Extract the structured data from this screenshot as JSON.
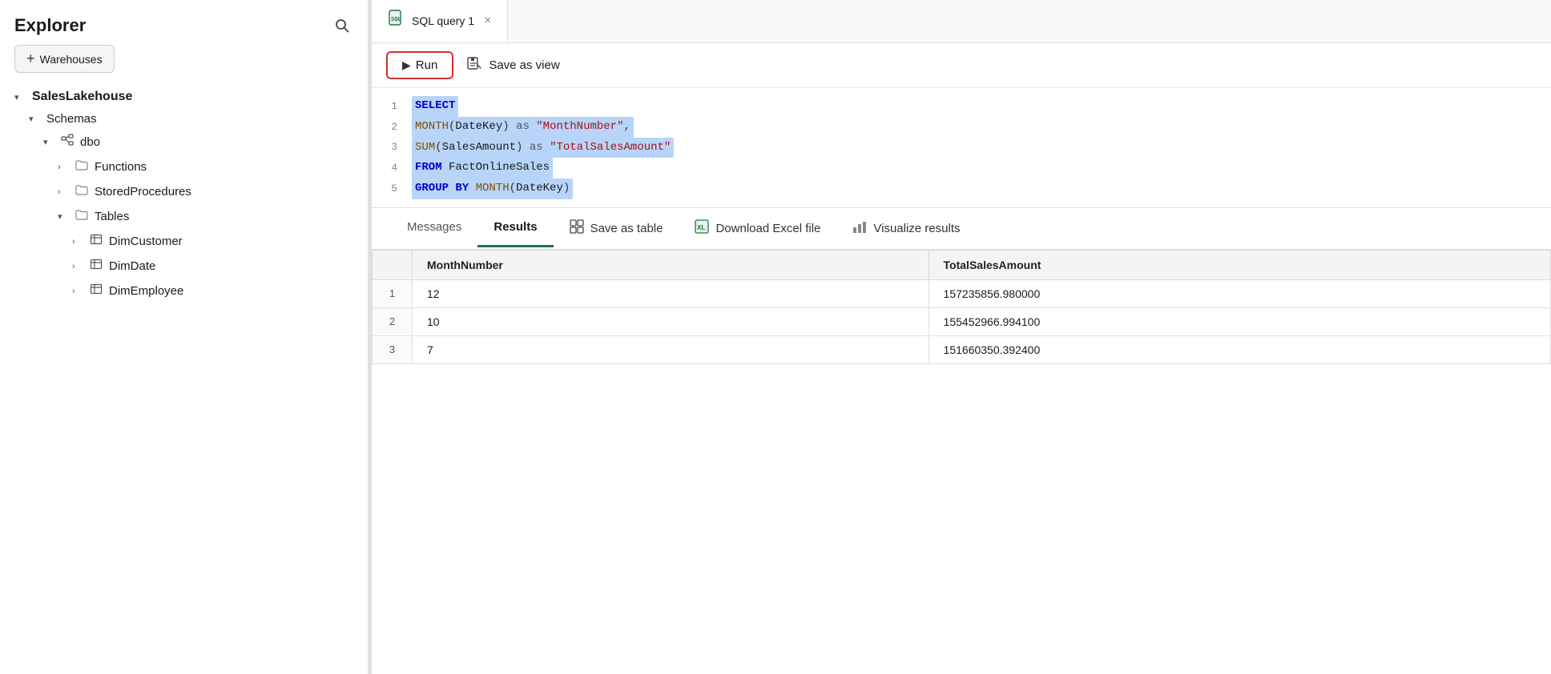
{
  "sidebar": {
    "title": "Explorer",
    "add_warehouses_label": "Warehouses",
    "tree": [
      {
        "id": "saleslakehouse",
        "label": "SalesLakehouse",
        "level": 0,
        "chevron": "down",
        "bold": true,
        "icon": ""
      },
      {
        "id": "schemas",
        "label": "Schemas",
        "level": 1,
        "chevron": "down",
        "icon": ""
      },
      {
        "id": "dbo",
        "label": "dbo",
        "level": 2,
        "chevron": "down",
        "icon": "schema"
      },
      {
        "id": "functions",
        "label": "Functions",
        "level": 3,
        "chevron": "right",
        "icon": "folder"
      },
      {
        "id": "storedprocedures",
        "label": "StoredProcedures",
        "level": 3,
        "chevron": "right",
        "icon": "folder"
      },
      {
        "id": "tables",
        "label": "Tables",
        "level": 3,
        "chevron": "down",
        "icon": "folder"
      },
      {
        "id": "dimcustomer",
        "label": "DimCustomer",
        "level": 4,
        "chevron": "right",
        "icon": "table"
      },
      {
        "id": "dimdate",
        "label": "DimDate",
        "level": 4,
        "chevron": "right",
        "icon": "table"
      },
      {
        "id": "dimemployee",
        "label": "DimEmployee",
        "level": 4,
        "chevron": "right",
        "icon": "table"
      }
    ]
  },
  "tab": {
    "label": "SQL query 1",
    "close_label": "×"
  },
  "toolbar": {
    "run_label": "Run",
    "save_view_label": "Save as view"
  },
  "code": {
    "lines": [
      {
        "num": "1",
        "content": "SELECT",
        "selected": true
      },
      {
        "num": "2",
        "content": "MONTH(DateKey) as \"MonthNumber\",",
        "selected": true
      },
      {
        "num": "3",
        "content": "SUM(SalesAmount) as \"TotalSalesAmount\"",
        "selected": true
      },
      {
        "num": "4",
        "content": "FROM FactOnlineSales",
        "selected": true
      },
      {
        "num": "5",
        "content": "GROUP BY MONTH(DateKey)",
        "selected": true
      }
    ]
  },
  "results": {
    "tabs": [
      {
        "id": "messages",
        "label": "Messages",
        "active": false
      },
      {
        "id": "results",
        "label": "Results",
        "active": true
      }
    ],
    "actions": [
      {
        "id": "save-table",
        "label": "Save as table",
        "icon": "grid"
      },
      {
        "id": "download-excel",
        "label": "Download Excel file",
        "icon": "excel"
      },
      {
        "id": "visualize",
        "label": "Visualize results",
        "icon": "chart"
      }
    ],
    "columns": [
      "",
      "MonthNumber",
      "TotalSalesAmount"
    ],
    "rows": [
      {
        "row": "1",
        "month": "12",
        "total": "157235856.980000"
      },
      {
        "row": "2",
        "month": "10",
        "total": "155452966.994100"
      },
      {
        "row": "3",
        "month": "7",
        "total": "151660350.392400"
      }
    ]
  }
}
